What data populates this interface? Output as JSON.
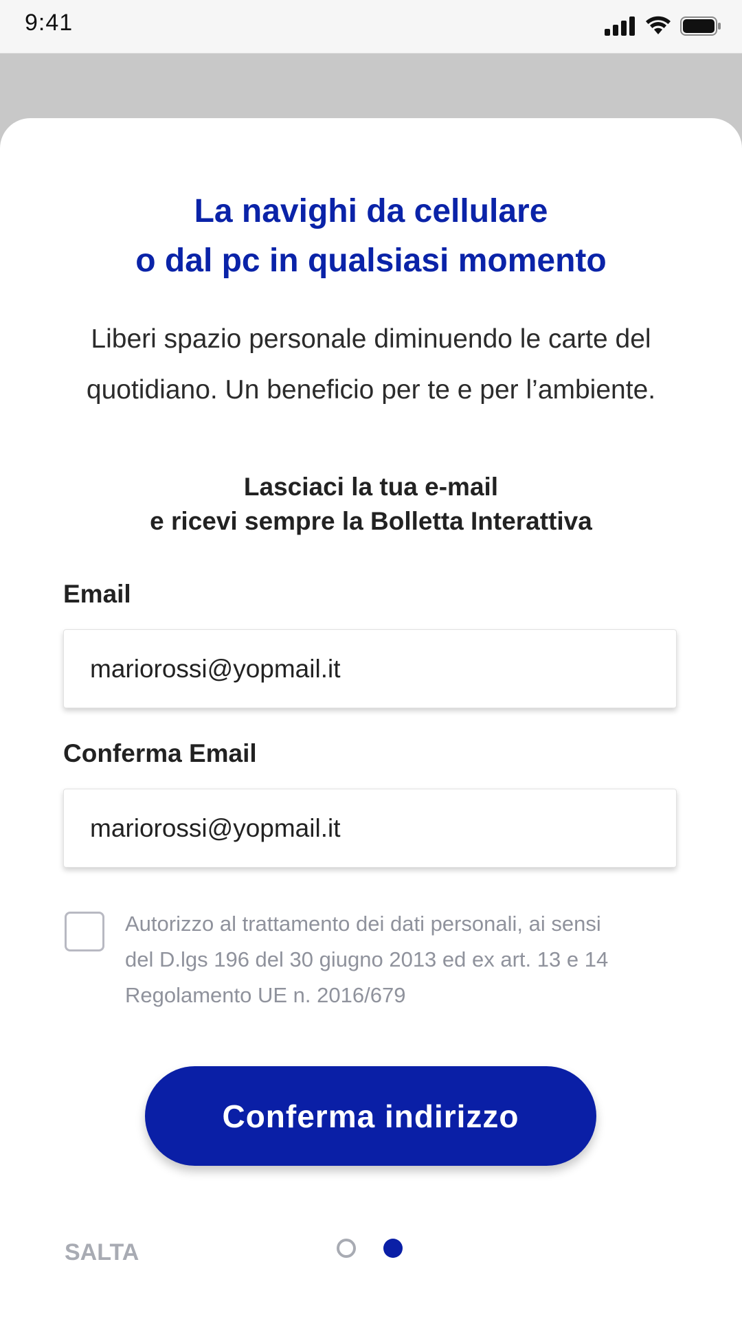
{
  "status_bar": {
    "time": "9:41"
  },
  "onboarding": {
    "title_line1": "La navighi da cellulare",
    "title_line2": "o dal pc in qualsiasi momento",
    "intro_line1": "Liberi spazio personale diminuendo le carte del",
    "intro_line2": "quotidiano. Un beneficio per te e per l’ambiente.",
    "cta_line1": "Lasciaci la tua e-mail",
    "cta_line2": "e ricevi sempre la Bolletta Interattiva"
  },
  "form": {
    "email_label": "Email",
    "email_value": "mariorossi@yopmail.it",
    "confirm_label": "Conferma Email",
    "confirm_value": "mariorossi@yopmail.it",
    "consent_line1": "Autorizzo al trattamento dei dati personali, ai sensi",
    "consent_line2": "del D.lgs 196 del 30 giugno 2013 ed ex art. 13 e 14",
    "consent_line3": "Regolamento UE n. 2016/679",
    "consent_checked": false,
    "submit_label": "Conferma indirizzo"
  },
  "footer": {
    "skip_label": "SALTA",
    "page_indicator": {
      "current": 2,
      "total": 2
    }
  },
  "colors": {
    "brand_blue": "#0a1fa6",
    "title_blue": "#0a23a8",
    "muted_gray": "#a8abb3"
  }
}
